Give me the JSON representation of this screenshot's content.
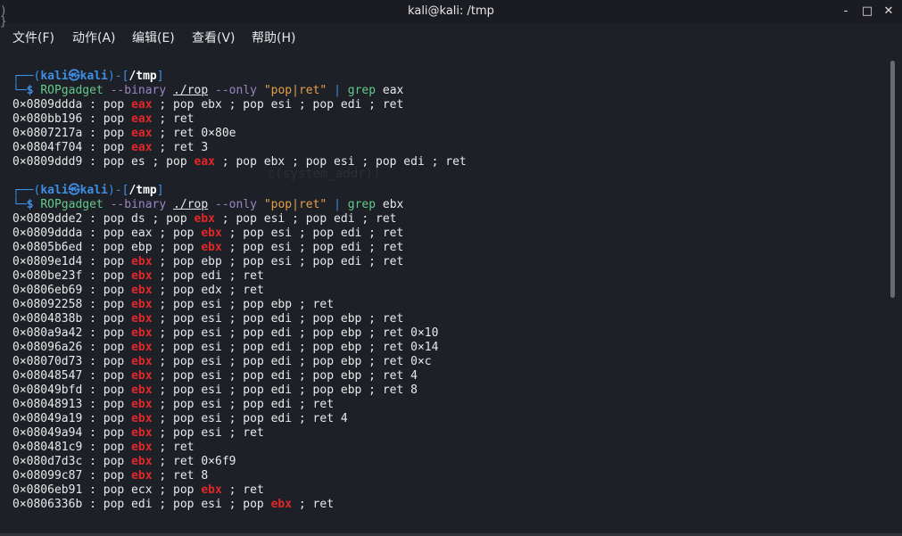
{
  "window": {
    "title": "kali@kali: /tmp",
    "controls": {
      "minimize": "-",
      "maximize": "□",
      "close": "✕"
    }
  },
  "menu": [
    "文件(F)",
    "动作(A)",
    "编辑(E)",
    "查看(V)",
    "帮助(H)"
  ],
  "ghost_text": "c(system_addr))",
  "sessions": [
    {
      "prompt": {
        "user": "kali",
        "at": "㉿",
        "host": "kali",
        "dir": "/tmp"
      },
      "command": {
        "program": "ROPgadget",
        "flag1": "--binary",
        "binary": "./rop",
        "flag2": "--only",
        "pattern": "\"pop|ret\"",
        "pipe": "|",
        "grep": "grep",
        "term": "eax"
      },
      "highlight": "eax",
      "output": [
        "0×0809ddda : pop eax ; pop ebx ; pop esi ; pop edi ; ret",
        "0×080bb196 : pop eax ; ret",
        "0×0807217a : pop eax ; ret 0×80e",
        "0×0804f704 : pop eax ; ret 3",
        "0×0809ddd9 : pop es ; pop eax ; pop ebx ; pop esi ; pop edi ; ret"
      ]
    },
    {
      "prompt": {
        "user": "kali",
        "at": "㉿",
        "host": "kali",
        "dir": "/tmp"
      },
      "command": {
        "program": "ROPgadget",
        "flag1": "--binary",
        "binary": "./rop",
        "flag2": "--only",
        "pattern": "\"pop|ret\"",
        "pipe": "|",
        "grep": "grep",
        "term": "ebx"
      },
      "highlight": "ebx",
      "output": [
        "0×0809dde2 : pop ds ; pop ebx ; pop esi ; pop edi ; ret",
        "0×0809ddda : pop eax ; pop ebx ; pop esi ; pop edi ; ret",
        "0×0805b6ed : pop ebp ; pop ebx ; pop esi ; pop edi ; ret",
        "0×0809e1d4 : pop ebx ; pop ebp ; pop esi ; pop edi ; ret",
        "0×080be23f : pop ebx ; pop edi ; ret",
        "0×0806eb69 : pop ebx ; pop edx ; ret",
        "0×08092258 : pop ebx ; pop esi ; pop ebp ; ret",
        "0×0804838b : pop ebx ; pop esi ; pop edi ; pop ebp ; ret",
        "0×080a9a42 : pop ebx ; pop esi ; pop edi ; pop ebp ; ret 0×10",
        "0×08096a26 : pop ebx ; pop esi ; pop edi ; pop ebp ; ret 0×14",
        "0×08070d73 : pop ebx ; pop esi ; pop edi ; pop ebp ; ret 0×c",
        "0×08048547 : pop ebx ; pop esi ; pop edi ; pop ebp ; ret 4",
        "0×08049bfd : pop ebx ; pop esi ; pop edi ; pop ebp ; ret 8",
        "0×08048913 : pop ebx ; pop esi ; pop edi ; ret",
        "0×08049a19 : pop ebx ; pop esi ; pop edi ; ret 4",
        "0×08049a94 : pop ebx ; pop esi ; ret",
        "0×080481c9 : pop ebx ; ret",
        "0×080d7d3c : pop ebx ; ret 0×6f9",
        "0×08099c87 : pop ebx ; ret 8",
        "0×0806eb91 : pop ecx ; pop ebx ; ret",
        "0×0806336b : pop edi ; pop esi ; pop ebx ; ret"
      ]
    }
  ],
  "colors": {
    "background": "#1e2027",
    "prompt": "#3e8ee6",
    "command": "#62c989",
    "option": "#9c83c7",
    "string": "#e6a04a",
    "highlight": "#e02828"
  }
}
